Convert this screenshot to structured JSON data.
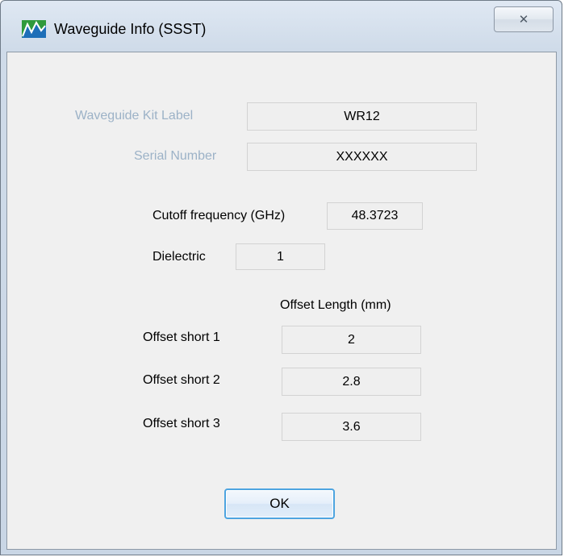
{
  "window": {
    "title": "Waveguide Info (SSST)",
    "close_label": "✕",
    "icon": "waveguide-app-icon"
  },
  "kit": {
    "label": "Waveguide Kit Label",
    "value": "WR12"
  },
  "serial": {
    "label": "Serial Number",
    "value": "XXXXXX"
  },
  "cutoff": {
    "label": "Cutoff frequency (GHz)",
    "value": "48.3723"
  },
  "dielectric": {
    "label": "Dielectric",
    "value": "1"
  },
  "offsets": {
    "header": "Offset Length (mm)",
    "rows": [
      {
        "label": "Offset short 1",
        "value": "2"
      },
      {
        "label": "Offset short 2",
        "value": "2.8"
      },
      {
        "label": "Offset short 3",
        "value": "3.6"
      }
    ]
  },
  "buttons": {
    "ok": "OK"
  },
  "colors": {
    "disabled_label": "#9cb2c7",
    "focus_border": "#4da4e0",
    "window_frame": "#cfdbe9"
  }
}
